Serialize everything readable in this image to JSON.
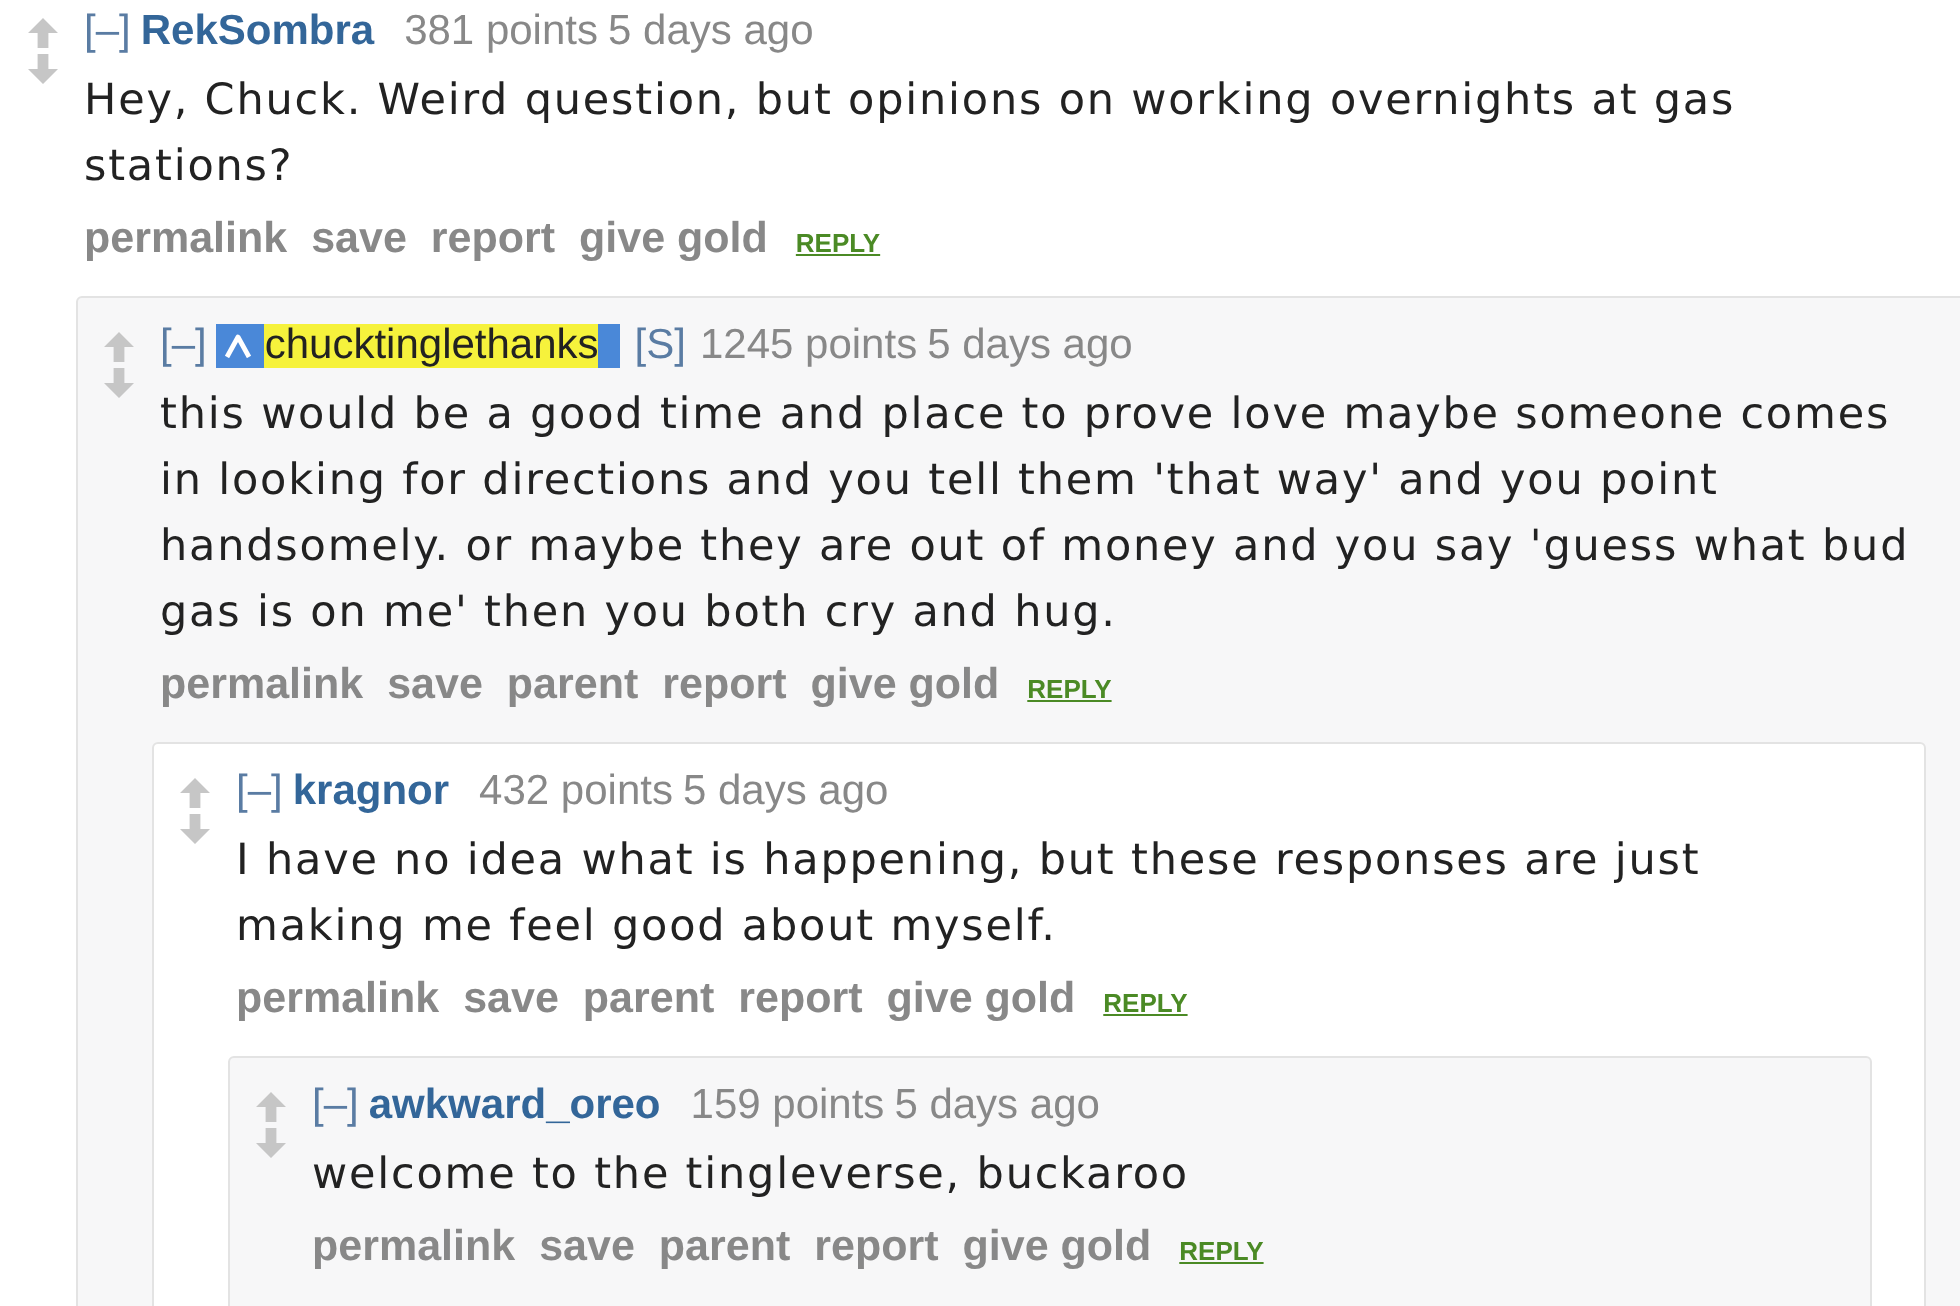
{
  "comments": [
    {
      "collapse": "[–]",
      "author": "RekSombra",
      "highlighted": false,
      "score": "381 points",
      "time": "5 days ago",
      "body": "Hey, Chuck. Weird question, but opinions on working overnights at gas stations?",
      "actions": [
        "permalink",
        "save",
        "report",
        "give gold"
      ],
      "reply": "REPLY",
      "children": [
        {
          "collapse": "[–]",
          "author": "chucktinglethanks",
          "highlighted": true,
          "submitter_tag": "[S]",
          "score": "1245 points",
          "time": "5 days ago",
          "body": "this would be a good time and place to prove love maybe someone comes in looking for directions and you tell them 'that way' and you point handsomely. or maybe they are out of money and you say 'guess what bud gas is on me' then you both cry and hug.",
          "actions": [
            "permalink",
            "save",
            "parent",
            "report",
            "give gold"
          ],
          "reply": "REPLY",
          "children": [
            {
              "collapse": "[–]",
              "author": "kragnor",
              "highlighted": false,
              "score": "432 points",
              "time": "5 days ago",
              "body": "I have no idea what is happening, but these responses are just making me feel good about myself.",
              "actions": [
                "permalink",
                "save",
                "parent",
                "report",
                "give gold"
              ],
              "reply": "REPLY",
              "children": [
                {
                  "collapse": "[–]",
                  "author": "awkward_oreo",
                  "highlighted": false,
                  "score": "159 points",
                  "time": "5 days ago",
                  "body": "welcome to the tingleverse, buckaroo",
                  "actions": [
                    "permalink",
                    "save",
                    "parent",
                    "report",
                    "give gold"
                  ],
                  "reply": "REPLY"
                }
              ]
            }
          ]
        }
      ]
    }
  ]
}
